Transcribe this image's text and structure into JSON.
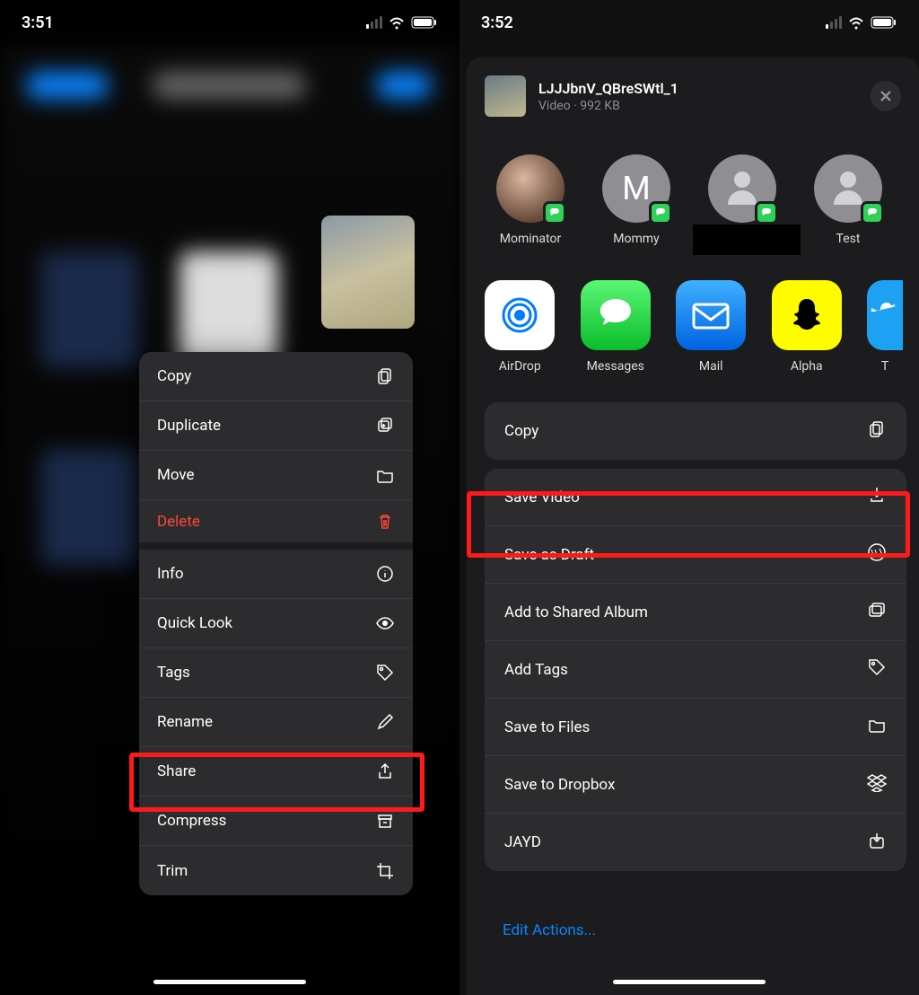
{
  "left": {
    "time": "3:51",
    "menu": {
      "copy": "Copy",
      "duplicate": "Duplicate",
      "move": "Move",
      "delete": "Delete",
      "info": "Info",
      "quicklook": "Quick Look",
      "tags": "Tags",
      "rename": "Rename",
      "share": "Share",
      "compress": "Compress",
      "trim": "Trim"
    }
  },
  "right": {
    "time": "3:52",
    "file": {
      "name": "LJJJbnV_QBreSWtl_1",
      "meta": "Video · 992 KB"
    },
    "contacts": [
      {
        "name": "Mominator"
      },
      {
        "name": "Mommy",
        "initial": "M"
      },
      {
        "name": ""
      },
      {
        "name": "Test"
      }
    ],
    "apps": {
      "airdrop": "AirDrop",
      "messages": "Messages",
      "mail": "Mail",
      "alpha": "Alpha",
      "twitter": "T"
    },
    "actions": {
      "copy": "Copy",
      "save_video": "Save Video",
      "save_draft": "Save as Draft",
      "shared_album": "Add to Shared Album",
      "add_tags": "Add Tags",
      "save_files": "Save to Files",
      "dropbox": "Save to Dropbox",
      "jayd": "JAYD"
    },
    "edit_actions": "Edit Actions..."
  }
}
